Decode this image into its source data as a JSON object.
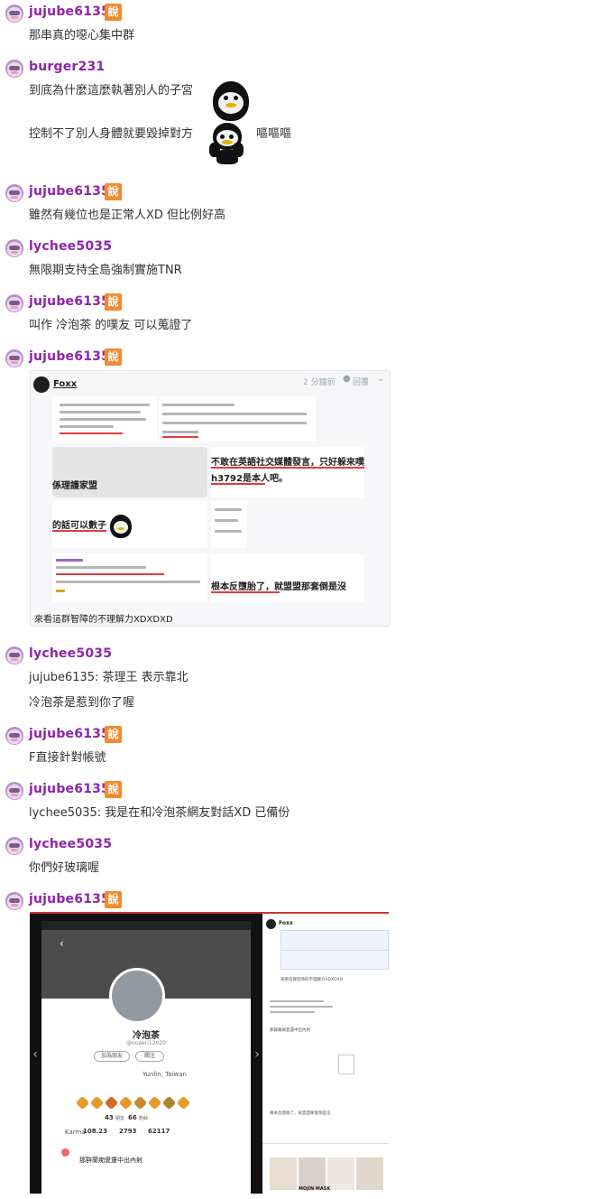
{
  "badge_char": "說",
  "messages": [
    {
      "user": "jujube6135",
      "lines": [
        "那串真的噁心集中群"
      ]
    },
    {
      "user": "burger231",
      "lines": [
        "到底為什麼這麼執著別人的子宮",
        "控制不了別人身體就要毀掉對方",
        "嘔嘔嘔"
      ]
    },
    {
      "user": "jujube6135",
      "lines": [
        "雖然有幾位也是正常人XD 但比例好高"
      ]
    },
    {
      "user": "lychee5035",
      "lines": [
        "無限期支持全島強制實施TNR"
      ]
    },
    {
      "user": "jujube6135",
      "lines": [
        "叫作 冷泡茶 的噗友 可以蒐證了"
      ]
    },
    {
      "user": "jujube6135",
      "lines": []
    },
    {
      "user": "lychee5035",
      "lines": [
        "jujube6135: 茶理王 表示靠北",
        "冷泡茶是惹到你了喔"
      ]
    },
    {
      "user": "jujube6135",
      "lines": [
        "F直接針對帳號"
      ]
    },
    {
      "user": "jujube6135",
      "lines": [
        "lychee5035: 我是在和冷泡茶網友對話XD 已備份"
      ]
    },
    {
      "user": "lychee5035",
      "lines": [
        "你們好玻璃喔"
      ]
    },
    {
      "user": "jujube6135",
      "lines": []
    }
  ],
  "screenshot1": {
    "author": "Foxx",
    "time": "2 分鐘前",
    "reply": "回覆",
    "caption": "來看這群智障的不理解力XDXDXD",
    "snip_a": "不敢在英語社交媒體發言，只好躲來噗浪",
    "snip_b": "h3792是本人吧。",
    "snip_c": "根本反墮胎了，就盟盟那套倒是沒",
    "snip_d": "的話可以數子宮",
    "snip_e": "係理護家盟"
  },
  "screenshot2": {
    "profile_name": "冷泡茶",
    "handle": "@ooaeri12020",
    "add_friend": "加為朋友",
    "follow": "關注",
    "stats": [
      {
        "value": "43",
        "label": "朋友"
      },
      {
        "value": "66",
        "label": "粉絲"
      }
    ],
    "karma": "108.23",
    "plurks": "2793",
    "responses": "62117",
    "karma_label": "Karma",
    "location": "Yunlin, Taiwan",
    "post_text": "那群蘭痴愛還中出內射",
    "right_author": "Foxx",
    "right_caption": "來看這群智障的不理解力XDXDXD",
    "right_post": "那群蘭痴愛還中出內射",
    "right_snip": "根本反墮胎了，就盟盟那套倒是沒",
    "right_ad": "MOJIN MASK"
  }
}
